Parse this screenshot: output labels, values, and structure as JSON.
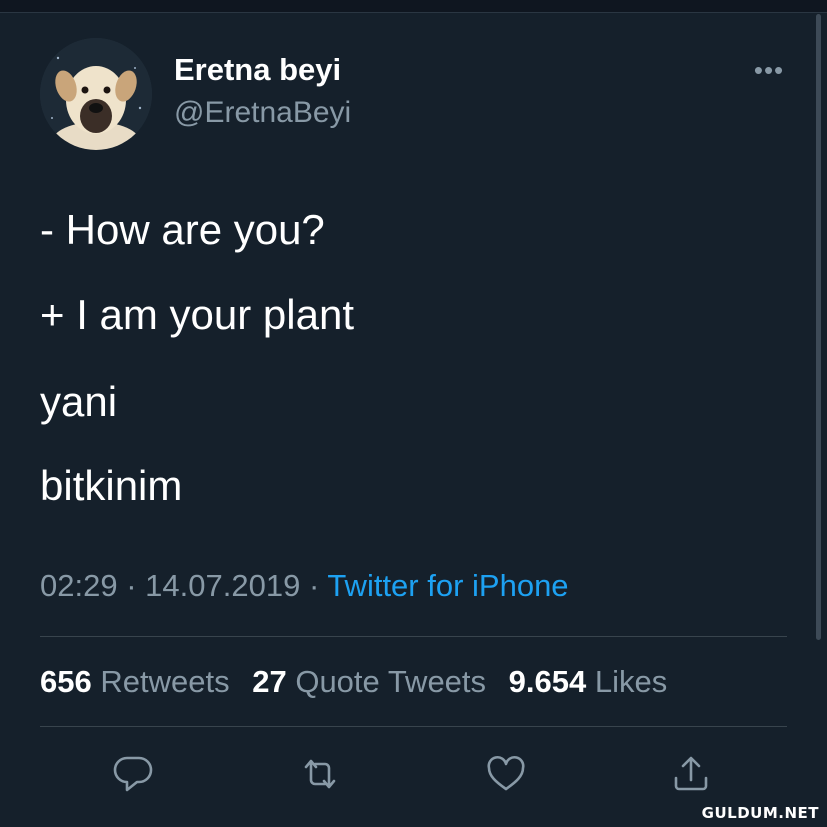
{
  "tweet": {
    "display_name": "Eretna beyi",
    "handle": "@EretnaBeyi",
    "more_icon": "more-horizontal-icon",
    "lines": [
      "- How are you?",
      "+ I am your plant",
      "yani",
      "bitkinim"
    ],
    "time": "02:29",
    "separator": "·",
    "date": "14.07.2019",
    "source": "Twitter for iPhone"
  },
  "stats": {
    "retweets_count": "656",
    "retweets_label": "Retweets",
    "quotes_count": "27",
    "quotes_label": "Quote Tweets",
    "likes_count": "9.654",
    "likes_label": "Likes"
  },
  "actions": {
    "icons": [
      "reply-icon",
      "retweet-icon",
      "like-icon",
      "share-icon"
    ]
  },
  "colors": {
    "background": "#15202b",
    "text": "#ffffff",
    "secondary": "#8899a6",
    "link": "#1da1f2",
    "divider": "#38444d"
  },
  "watermark": "GULDUM.NET"
}
